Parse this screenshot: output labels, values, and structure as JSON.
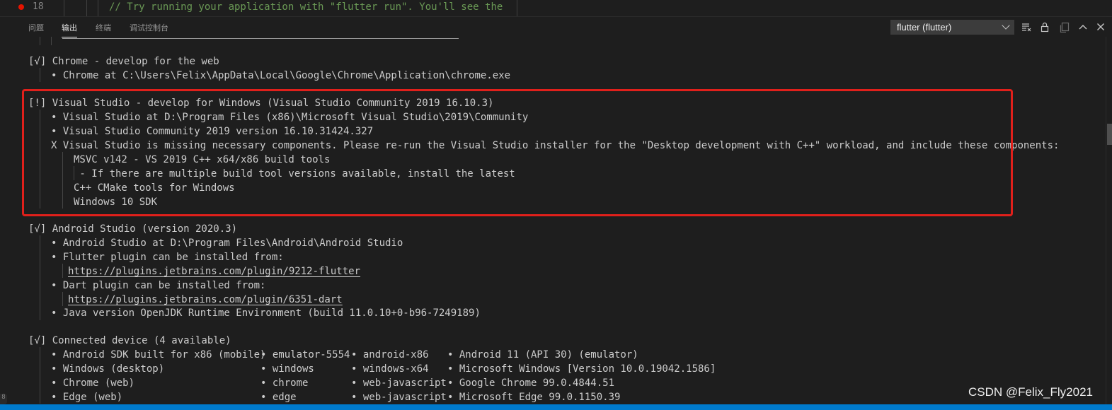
{
  "editor": {
    "line_number": "18",
    "code_line": "// Try running your application with \"flutter run\". You'll see the"
  },
  "panel": {
    "tabs": [
      {
        "label": "问题"
      },
      {
        "label": "输出",
        "active": true
      },
      {
        "label": "终端"
      },
      {
        "label": "调试控制台"
      }
    ],
    "channel_select_value": "flutter (flutter)",
    "icons": [
      "clear-output-icon",
      "lock-scroll-icon",
      "open-log-icon",
      "maximize-panel-icon",
      "close-panel-icon"
    ]
  },
  "output": {
    "chrome_header": "[√] Chrome - develop for the web",
    "chrome_line": "• Chrome at C:\\Users\\Felix\\AppData\\Local\\Google\\Chrome\\Application\\chrome.exe",
    "vs_header": "[!] Visual Studio - develop for Windows (Visual Studio Community 2019 16.10.3)",
    "vs_lines": [
      "• Visual Studio at D:\\Program Files (x86)\\Microsoft Visual Studio\\2019\\Community",
      "• Visual Studio Community 2019 version 16.10.31424.327",
      "X Visual Studio is missing necessary components. Please re-run the Visual Studio installer for the \"Desktop development with C++\" workload, and include these components:"
    ],
    "vs_components": [
      "MSVC v142 - VS 2019 C++ x64/x86 build tools",
      " - If there are multiple build tool versions available, install the latest",
      "C++ CMake tools for Windows",
      "Windows 10 SDK"
    ],
    "as_header": "[√] Android Studio (version 2020.3)",
    "as_line1": "• Android Studio at D:\\Program Files\\Android\\Android Studio",
    "as_line2": "• Flutter plugin can be installed from:",
    "as_link1": "https://plugins.jetbrains.com/plugin/9212-flutter",
    "as_line3": "• Dart plugin can be installed from:",
    "as_link2": "https://plugins.jetbrains.com/plugin/6351-dart",
    "as_line4": "• Java version OpenJDK Runtime Environment (build 11.0.10+0-b96-7249189)",
    "cd_header": "[√] Connected device (4 available)",
    "devices": [
      [
        "• Android SDK built for x86 (mobile)",
        "• emulator-5554",
        "• android-x86",
        "• Android 11 (API 30) (emulator)"
      ],
      [
        "• Windows (desktop)",
        "• windows",
        "• windows-x64",
        "• Microsoft Windows [Version 10.0.19042.1586]"
      ],
      [
        "• Chrome (web)",
        "• chrome",
        "• web-javascript",
        "• Google Chrome 99.0.4844.51"
      ],
      [
        "• Edge (web)",
        "• edge",
        "• web-javascript",
        "• Microsoft Edge 99.0.1150.39"
      ]
    ]
  },
  "gutter_number": "8",
  "watermark": "CSDN @Felix_Fly2021",
  "colors": {
    "background": "#1e1e1e",
    "highlight_box": "#e0201b",
    "status_bar": "#007acc",
    "comment": "#6a9955"
  }
}
